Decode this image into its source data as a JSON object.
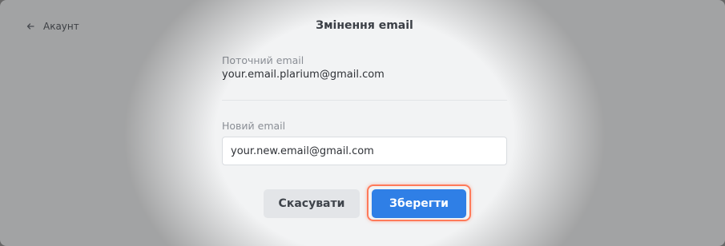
{
  "header": {
    "back_label": "Акаунт",
    "title": "Змінення email"
  },
  "current_email": {
    "label": "Поточний email",
    "value": "your.email.plarium@gmail.com"
  },
  "new_email": {
    "label": "Новий email",
    "value": "your.new.email@gmail.com"
  },
  "actions": {
    "cancel_label": "Скасувати",
    "save_label": "Зберегти"
  },
  "colors": {
    "primary": "#2f7fe6",
    "highlight_ring": "#ff7a59",
    "secondary_button": "#e3e5e8"
  },
  "icons": {
    "back": "arrow-left-icon"
  }
}
